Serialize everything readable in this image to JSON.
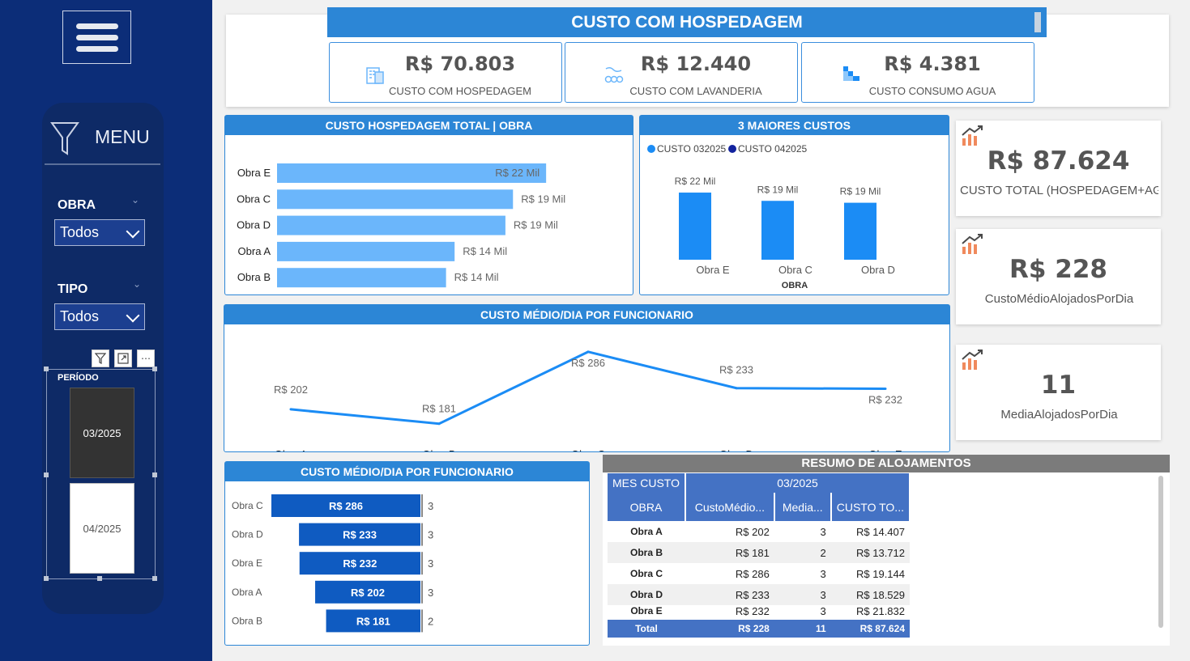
{
  "sidebar": {
    "menu_label": "MENU",
    "filters": [
      {
        "title": "OBRA",
        "value": "Todos"
      },
      {
        "title": "TIPO",
        "value": "Todos"
      }
    ],
    "periodo": {
      "title": "PERÍODO",
      "options": [
        {
          "label": "03/2025",
          "selected": true
        },
        {
          "label": "04/2025",
          "selected": false
        }
      ]
    }
  },
  "header": {
    "title": "CUSTO COM HOSPEDAGEM",
    "kpis": [
      {
        "value": "R$ 70.803",
        "label": "CUSTO COM HOSPEDAGEM",
        "icon": "building-icon"
      },
      {
        "value": "R$ 12.440",
        "label": "CUSTO COM LAVANDERIA",
        "icon": "laundry-icon"
      },
      {
        "value": "R$ 4.381",
        "label": "CUSTO CONSUMO AGUA",
        "icon": "water-steps-icon"
      }
    ]
  },
  "side_kpis": [
    {
      "value": "R$ 87.624",
      "label": "CUSTO TOTAL (HOSPEDAGEM+AG..."
    },
    {
      "value": "R$ 228",
      "label": "CustoMédioAlojadosPorDia"
    },
    {
      "value": "11",
      "label": "MediaAlojadosPorDia"
    }
  ],
  "colors": {
    "navy": "#0c2d78",
    "blue": "#2c86d6",
    "bar_light": "#6bb6fb",
    "bar_mid": "#1b8cf5",
    "bar_dark": "#0f5bc1",
    "table_blue": "#4472c4"
  },
  "chart_data": [
    {
      "type": "bar",
      "orientation": "horizontal",
      "title": "CUSTO HOSPEDAGEM TOTAL | OBRA",
      "categories": [
        "Obra E",
        "Obra C",
        "Obra D",
        "Obra A",
        "Obra B"
      ],
      "values": [
        21832,
        19144,
        18529,
        14407,
        13712
      ],
      "labels": [
        "R$ 22 Mil",
        "R$ 19 Mil",
        "R$ 19 Mil",
        "R$ 14 Mil",
        "R$ 14 Mil"
      ]
    },
    {
      "type": "bar",
      "title": "3 MAIORES CUSTOS",
      "xlabel": "OBRA",
      "legend": [
        "CUSTO 032025",
        "CUSTO 042025"
      ],
      "legend_colors": [
        "#1b8cf5",
        "#12239e"
      ],
      "categories": [
        "Obra E",
        "Obra C",
        "Obra D"
      ],
      "values": [
        21832,
        19144,
        18529
      ],
      "labels": [
        "R$ 22 Mil",
        "R$ 19 Mil",
        "R$ 19 Mil"
      ]
    },
    {
      "type": "line",
      "title": "CUSTO MÉDIO/DIA POR FUNCIONARIO",
      "categories": [
        "Obra A",
        "Obra B",
        "Obra C",
        "Obra D",
        "Obra E"
      ],
      "values": [
        202,
        181,
        286,
        233,
        232
      ],
      "labels": [
        "R$ 202",
        "R$ 181",
        "R$ 286",
        "R$ 233",
        "R$ 232"
      ]
    },
    {
      "type": "bar",
      "orientation": "horizontal",
      "title": "CUSTO MÉDIO/DIA POR FUNCIONARIO",
      "categories": [
        "Obra C",
        "Obra D",
        "Obra E",
        "Obra A",
        "Obra B"
      ],
      "values": [
        286,
        233,
        232,
        202,
        181
      ],
      "labels": [
        "R$ 286",
        "R$ 233",
        "R$ 232",
        "R$ 202",
        "R$ 181"
      ],
      "secondary": [
        "3",
        "3",
        "3",
        "3",
        "2"
      ]
    }
  ],
  "resumo": {
    "title": "RESUMO DE ALOJAMENTOS",
    "mes_label": "MES CUSTO",
    "mes_value": "03/2025",
    "columns": [
      "OBRA",
      "CustoMédio...",
      "Media...",
      "CUSTO TO..."
    ],
    "rows": [
      [
        "Obra A",
        "R$ 202",
        "3",
        "R$ 14.407"
      ],
      [
        "Obra B",
        "R$ 181",
        "2",
        "R$ 13.712"
      ],
      [
        "Obra C",
        "R$ 286",
        "3",
        "R$ 19.144"
      ],
      [
        "Obra D",
        "R$ 233",
        "3",
        "R$ 18.529"
      ],
      [
        "Obra E",
        "R$ 232",
        "3",
        "R$ 21.832"
      ]
    ],
    "total": [
      "Total",
      "R$ 228",
      "11",
      "R$ 87.624"
    ]
  }
}
